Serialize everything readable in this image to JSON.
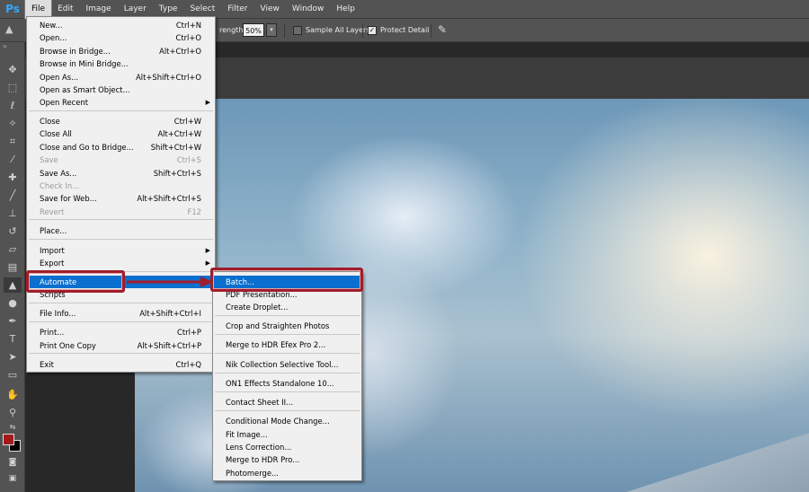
{
  "app": {
    "logo": "Ps"
  },
  "menubar": {
    "items": [
      "File",
      "Edit",
      "Image",
      "Layer",
      "Type",
      "Select",
      "Filter",
      "View",
      "Window",
      "Help"
    ]
  },
  "options_bar": {
    "strength_label": "rength:",
    "strength_value": "50%",
    "sample_all_layers": "Sample All Layers",
    "sample_all_layers_checked": false,
    "protect_detail": "Protect Detail",
    "protect_detail_checked": true
  },
  "file_menu": {
    "items": [
      {
        "label": "New...",
        "shortcut": "Ctrl+N"
      },
      {
        "label": "Open...",
        "shortcut": "Ctrl+O"
      },
      {
        "label": "Browse in Bridge...",
        "shortcut": "Alt+Ctrl+O"
      },
      {
        "label": "Browse in Mini Bridge...",
        "shortcut": ""
      },
      {
        "label": "Open As...",
        "shortcut": "Alt+Shift+Ctrl+O"
      },
      {
        "label": "Open as Smart Object...",
        "shortcut": ""
      },
      {
        "label": "Open Recent",
        "shortcut": "",
        "submenu": true
      },
      {
        "label": "Close",
        "shortcut": "Ctrl+W"
      },
      {
        "label": "Close All",
        "shortcut": "Alt+Ctrl+W"
      },
      {
        "label": "Close and Go to Bridge...",
        "shortcut": "Shift+Ctrl+W"
      },
      {
        "label": "Save",
        "shortcut": "Ctrl+S",
        "disabled": true
      },
      {
        "label": "Save As...",
        "shortcut": "Shift+Ctrl+S"
      },
      {
        "label": "Check In...",
        "shortcut": "",
        "disabled": true
      },
      {
        "label": "Save for Web...",
        "shortcut": "Alt+Shift+Ctrl+S"
      },
      {
        "label": "Revert",
        "shortcut": "F12",
        "disabled": true
      },
      {
        "label": "Place...",
        "shortcut": ""
      },
      {
        "label": "Import",
        "shortcut": "",
        "submenu": true
      },
      {
        "label": "Export",
        "shortcut": "",
        "submenu": true
      },
      {
        "label": "Automate",
        "shortcut": "",
        "submenu": true,
        "highlighted": true
      },
      {
        "label": "Scripts",
        "shortcut": ""
      },
      {
        "label": "File Info...",
        "shortcut": "Alt+Shift+Ctrl+I"
      },
      {
        "label": "Print...",
        "shortcut": "Ctrl+P"
      },
      {
        "label": "Print One Copy",
        "shortcut": "Alt+Shift+Ctrl+P"
      },
      {
        "label": "Exit",
        "shortcut": "Ctrl+Q"
      }
    ]
  },
  "automate_menu": {
    "items": [
      {
        "label": "Batch...",
        "highlighted": true
      },
      {
        "label": "PDF Presentation..."
      },
      {
        "label": "Create Droplet..."
      },
      {
        "label": "Crop and Straighten Photos"
      },
      {
        "label": "Merge to HDR Efex Pro 2..."
      },
      {
        "label": "Nik Collection Selective Tool..."
      },
      {
        "label": "ON1 Effects Standalone 10..."
      },
      {
        "label": "Contact Sheet II..."
      },
      {
        "label": "Conditional Mode Change..."
      },
      {
        "label": "Fit Image..."
      },
      {
        "label": "Lens Correction..."
      },
      {
        "label": "Merge to HDR Pro..."
      },
      {
        "label": "Photomerge..."
      }
    ]
  },
  "colors": {
    "foreground": "#a41a1a",
    "background": "#000000",
    "menu_highlight": "#0a6fce",
    "annotation": "#a11d2a"
  },
  "icons": {
    "tools": [
      "move-icon",
      "marquee-icon",
      "lasso-icon",
      "quick-select-icon",
      "crop-icon",
      "eyedropper-icon",
      "healing-brush-icon",
      "brush-icon",
      "clone-stamp-icon",
      "history-brush-icon",
      "eraser-icon",
      "gradient-icon",
      "sharpen-icon",
      "dodge-icon",
      "pen-icon",
      "type-icon",
      "path-select-icon",
      "shape-icon",
      "hand-icon",
      "zoom-icon"
    ]
  }
}
